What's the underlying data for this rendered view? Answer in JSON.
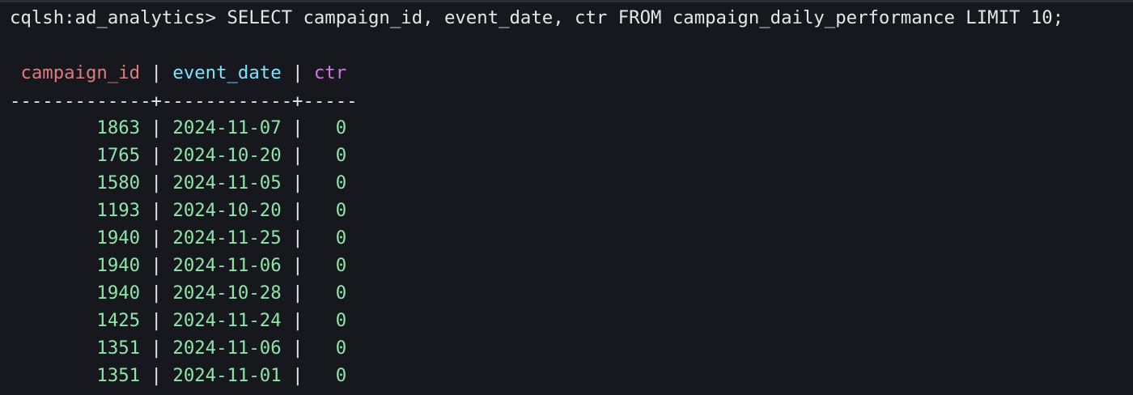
{
  "prompt": "cqlsh:ad_analytics> ",
  "command": "SELECT campaign_id, event_date, ctr FROM campaign_daily_performance LIMIT 10;",
  "columns": [
    "campaign_id",
    "event_date",
    "ctr"
  ],
  "rule": "-------------+------------+-----",
  "rows": [
    {
      "campaign_id": "1863",
      "event_date": "2024-11-07",
      "ctr": "0"
    },
    {
      "campaign_id": "1765",
      "event_date": "2024-10-20",
      "ctr": "0"
    },
    {
      "campaign_id": "1580",
      "event_date": "2024-11-05",
      "ctr": "0"
    },
    {
      "campaign_id": "1193",
      "event_date": "2024-10-20",
      "ctr": "0"
    },
    {
      "campaign_id": "1940",
      "event_date": "2024-11-25",
      "ctr": "0"
    },
    {
      "campaign_id": "1940",
      "event_date": "2024-11-06",
      "ctr": "0"
    },
    {
      "campaign_id": "1940",
      "event_date": "2024-10-28",
      "ctr": "0"
    },
    {
      "campaign_id": "1425",
      "event_date": "2024-11-24",
      "ctr": "0"
    },
    {
      "campaign_id": "1351",
      "event_date": "2024-11-06",
      "ctr": "0"
    },
    {
      "campaign_id": "1351",
      "event_date": "2024-11-01",
      "ctr": "0"
    }
  ],
  "colors": {
    "background": "#16181d",
    "text": "#e6e6e6",
    "campaign_id_header": "#e07b7b",
    "event_date_header": "#7fe3ff",
    "ctr_header": "#d774e6",
    "values": "#8de6a6"
  }
}
